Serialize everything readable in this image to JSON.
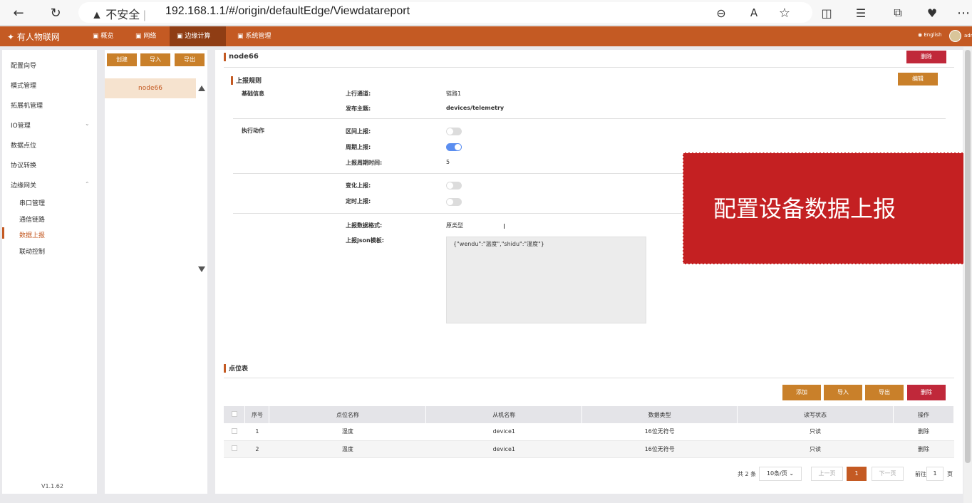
{
  "browser": {
    "insecure_label": "不安全",
    "url": "192.168.1.1/#/origin/defaultEdge/Viewdatareport"
  },
  "topnav": {
    "logo": "有人物联网",
    "items": [
      "概览",
      "网络",
      "边缘计算",
      "系统管理"
    ],
    "active": "边缘计算",
    "lang": "English",
    "user": "adr"
  },
  "sidebar": {
    "items": [
      "配置向导",
      "模式管理",
      "拓展机管理",
      "IO管理",
      "数据点位",
      "协议转换",
      "边缘网关"
    ],
    "sub_items": [
      "串口管理",
      "通信链路",
      "数据上报",
      "联动控制"
    ],
    "active_sub": "数据上报",
    "version": "V1.1.62"
  },
  "nodepanel": {
    "create": "创建",
    "import": "导入",
    "export": "导出",
    "node": "node66"
  },
  "main": {
    "node_title": "node66",
    "delete_btn": "删除",
    "edit_btn": "编辑",
    "rule_title": "上报规则",
    "basic_info": "基础信息",
    "uplink_label": "上行通道:",
    "uplink_value": "链路1",
    "topic_label": "发布主题:",
    "topic_value": "devices/telemetry",
    "action_title": "执行动作",
    "interval_label": "区间上报:",
    "interval_on": false,
    "period_label": "周期上报:",
    "period_on": true,
    "period_time_label": "上报周期时间:",
    "period_time_value": "5",
    "change_label": "变化上报:",
    "change_on": false,
    "timed_label": "定时上报:",
    "timed_on": false,
    "format_label": "上报数据格式:",
    "format_value": "原类型",
    "json_label": "上报json模板:",
    "json_value": "{\"wendu\":\"温度\",\"shidu\":\"湿度\"}",
    "points_title": "点位表",
    "add_btn": "添加",
    "import_btn": "导入",
    "export_btn": "导出",
    "delete_btn2": "删除"
  },
  "table": {
    "headers": [
      "序号",
      "点位名称",
      "从机名称",
      "数据类型",
      "读写状态",
      "操作"
    ],
    "rows": [
      [
        "1",
        "湿度",
        "device1",
        "16位无符号",
        "只读",
        "删除"
      ],
      [
        "2",
        "温度",
        "device1",
        "16位无符号",
        "只读",
        "删除"
      ]
    ]
  },
  "pagination": {
    "total": "共 2 条",
    "page_size": "10条/页",
    "prev": "上一页",
    "current": "1",
    "next": "下一页",
    "goto": "前往",
    "goto_value": "1",
    "page_unit": "页"
  },
  "overlay": {
    "text": "配置设备数据上报"
  },
  "colors": {
    "brand": "#c45a23",
    "brand_dark": "#8f3d14",
    "button": "#c9802a",
    "danger": "#c0283a",
    "overlay": "#c42022",
    "toggle_on": "#5b8ef0"
  }
}
